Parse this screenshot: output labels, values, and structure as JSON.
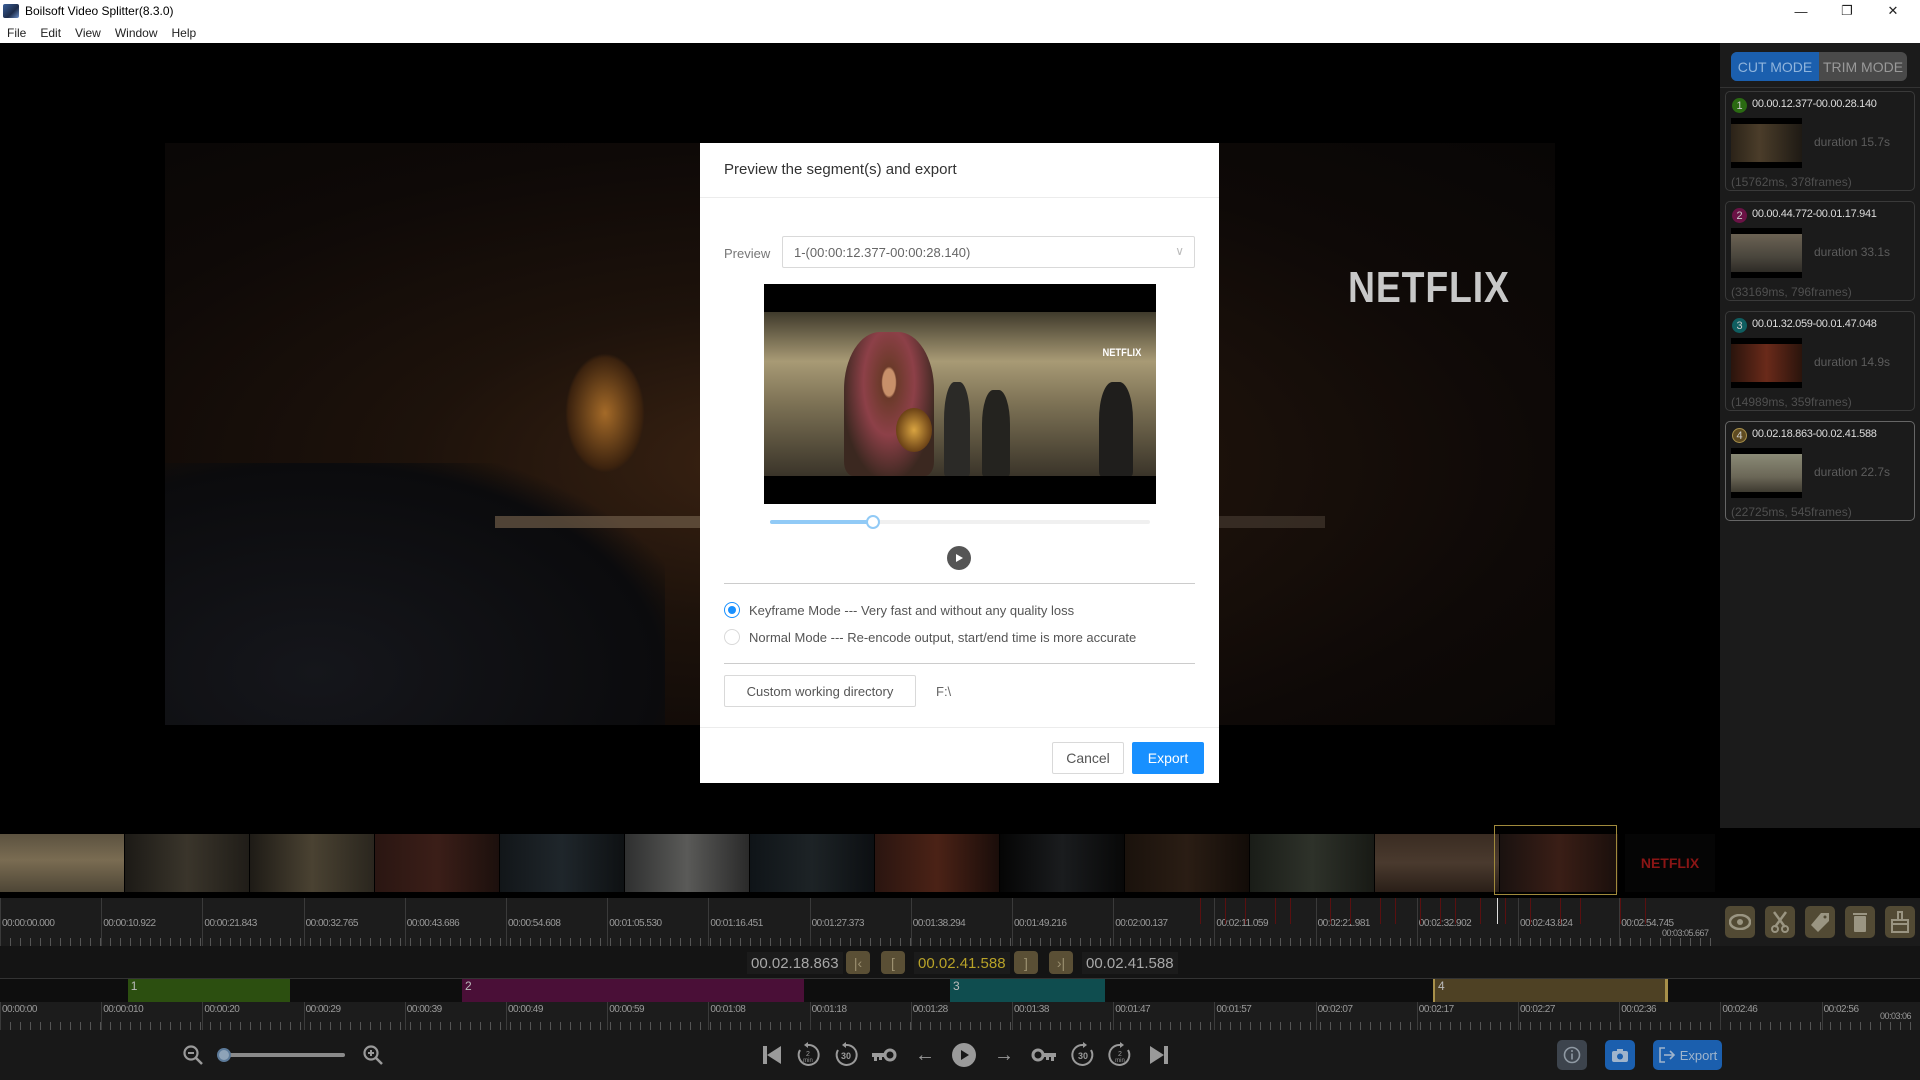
{
  "window": {
    "title": "Boilsoft Video Splitter(8.3.0)",
    "controls": {
      "minimize": "—",
      "restore": "❐",
      "close": "✕"
    }
  },
  "menu": [
    "File",
    "Edit",
    "View",
    "Window",
    "Help"
  ],
  "video": {
    "watermark": "NETFLIX"
  },
  "mode_switch": {
    "cut": "CUT MODE",
    "trim": "TRIM MODE",
    "active": "cut"
  },
  "segments": [
    {
      "index": "1",
      "range": "00.00.12.377-00.00.28.140",
      "duration": "duration 15.7s",
      "info": "(15762ms, 378frames)",
      "color": "#2a6a12"
    },
    {
      "index": "2",
      "range": "00.00.44.772-00.01.17.941",
      "duration": "duration 33.1s",
      "info": "(33169ms, 796frames)",
      "color": "#6a1245"
    },
    {
      "index": "3",
      "range": "00.01.32.059-00.01.47.048",
      "duration": "duration 14.9s",
      "info": "(14989ms, 359frames)",
      "color": "#0f5e60"
    },
    {
      "index": "4",
      "range": "00.02.18.863-00.02.41.588",
      "duration": "duration 22.7s",
      "info": "(22725ms, 545frames)",
      "color": "#5e4a20",
      "selected": true
    }
  ],
  "ruler_top": [
    "00:00:00.000",
    "00:00:10.922",
    "00:00:21.843",
    "00:00:32.765",
    "00:00:43.686",
    "00:00:54.608",
    "00:01:05.530",
    "00:01:16.451",
    "00:01:27.373",
    "00:01:38.294",
    "00:01:49.216",
    "00:02:00.137",
    "00:02:11.059",
    "00:02:21.981",
    "00:02:32.902",
    "00:02:43.824",
    "00:02:54.745"
  ],
  "ruler_top_end": "00:03:05.667",
  "tools": [
    "preview-eye",
    "cut-scissors",
    "tag",
    "delete-trash",
    "clear-brush"
  ],
  "timebar": {
    "start": "00.02.18.863",
    "current": "00.02.41.588",
    "end": "00.02.41.588",
    "btn_go_start": "K",
    "btn_set_start": "[",
    "btn_set_end": "]",
    "btn_go_end": "K"
  },
  "seg_track": [
    {
      "label": "1",
      "start_s": 12.377,
      "end_s": 28.14,
      "color": "#2c4f10"
    },
    {
      "label": "2",
      "start_s": 44.772,
      "end_s": 77.941,
      "color": "#4a0f37"
    },
    {
      "label": "3",
      "start_s": 92.059,
      "end_s": 107.048,
      "color": "#0f4d4f"
    },
    {
      "label": "4",
      "start_s": 138.863,
      "end_s": 161.588,
      "color": "#4e4124"
    }
  ],
  "total_s": 185.667,
  "ruler_bottom": [
    "00:00:00",
    "00:00:010",
    "00:00:20",
    "00:00:29",
    "00:00:39",
    "00:00:49",
    "00:00:59",
    "00:01:08",
    "00:01:18",
    "00:01:28",
    "00:01:38",
    "00:01:47",
    "00:01:57",
    "00:02:07",
    "00:02:17",
    "00:02:27",
    "00:02:36",
    "00:02:46",
    "00:02:56"
  ],
  "ruler_bottom_end": "00:03:06",
  "zoom_level": 0.0,
  "playback": {
    "buttons": [
      "skip-start",
      "rewind-2min",
      "rewind-30s",
      "prev-keyframe",
      "prev-frame",
      "play",
      "next-frame",
      "next-keyframe",
      "forward-30s",
      "forward-2min",
      "skip-end"
    ],
    "rewind2_label": "2\nmin",
    "rewind30_label": "30",
    "fwd30_label": "30",
    "fwd2_label": "2\nmin"
  },
  "bottom_right": {
    "export_label": "Export"
  },
  "dialog": {
    "title": "Preview the segment(s) and export",
    "preview_label": "Preview",
    "preview_selected": "1-(00:00:12.377-00:00:28.140)",
    "preview_watermark": "NETFLIX",
    "preview_progress": 0.27,
    "modes": [
      {
        "label": "Keyframe Mode --- Very fast and without any quality loss",
        "checked": true
      },
      {
        "label": "Normal Mode --- Re-encode output, start/end time is more accurate",
        "checked": false
      }
    ],
    "custom_dir_label": "Custom working directory",
    "dir_value": "F:\\",
    "cancel_label": "Cancel",
    "export_label": "Export"
  }
}
